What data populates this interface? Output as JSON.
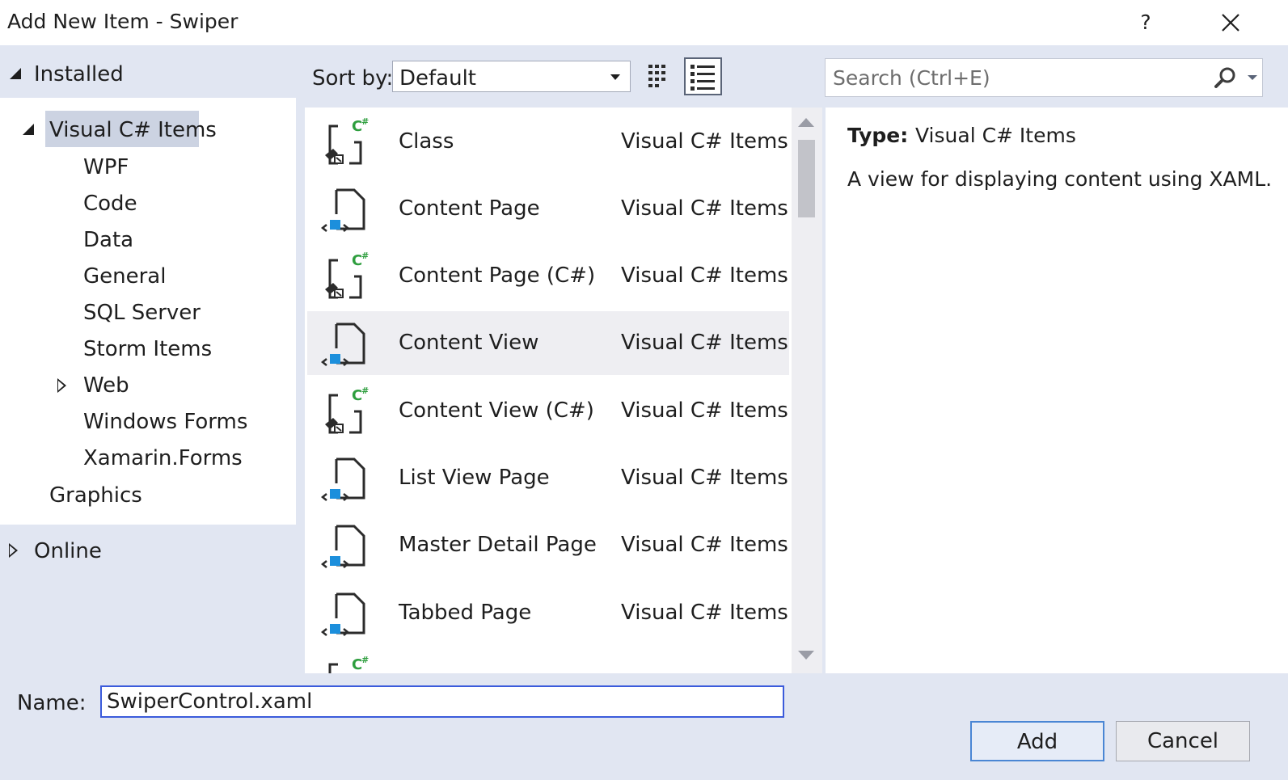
{
  "window": {
    "title": "Add New Item - Swiper",
    "help_label": "?"
  },
  "tree": {
    "installed_label": "Installed",
    "visual_csharp_label": "Visual C# Items",
    "children": [
      "WPF",
      "Code",
      "Data",
      "General",
      "SQL Server",
      "Storm Items",
      "Web",
      "Windows Forms",
      "Xamarin.Forms"
    ],
    "graphics_label": "Graphics",
    "online_label": "Online"
  },
  "toolbar": {
    "sort_by_label": "Sort by:",
    "sort_value": "Default",
    "search_placeholder": "Search (Ctrl+E)"
  },
  "templates": [
    {
      "name": "Class",
      "category": "Visual C# Items",
      "icon": "csharp-code-icon"
    },
    {
      "name": "Content Page",
      "category": "Visual C# Items",
      "icon": "xaml-page-icon"
    },
    {
      "name": "Content Page (C#)",
      "category": "Visual C# Items",
      "icon": "csharp-code-icon"
    },
    {
      "name": "Content View",
      "category": "Visual C# Items",
      "icon": "xaml-page-icon",
      "selected": true
    },
    {
      "name": "Content View (C#)",
      "category": "Visual C# Items",
      "icon": "csharp-code-icon"
    },
    {
      "name": "List View Page",
      "category": "Visual C# Items",
      "icon": "xaml-page-icon"
    },
    {
      "name": "Master Detail Page",
      "category": "Visual C# Items",
      "icon": "xaml-page-icon"
    },
    {
      "name": "Tabbed Page",
      "category": "Visual C# Items",
      "icon": "xaml-page-icon"
    }
  ],
  "details": {
    "type_key": "Type:",
    "type_value": "Visual C# Items",
    "description": "A view for displaying content using XAML."
  },
  "footer": {
    "name_label": "Name:",
    "name_value": "SwiperControl.xaml",
    "add_label": "Add",
    "cancel_label": "Cancel"
  },
  "colors": {
    "panel": "#e1e6f2",
    "selection": "#ccd3e2",
    "accent_green": "#2e9e3e",
    "accent_blue": "#1c8fdc",
    "focus_border": "#3b5bdb"
  }
}
